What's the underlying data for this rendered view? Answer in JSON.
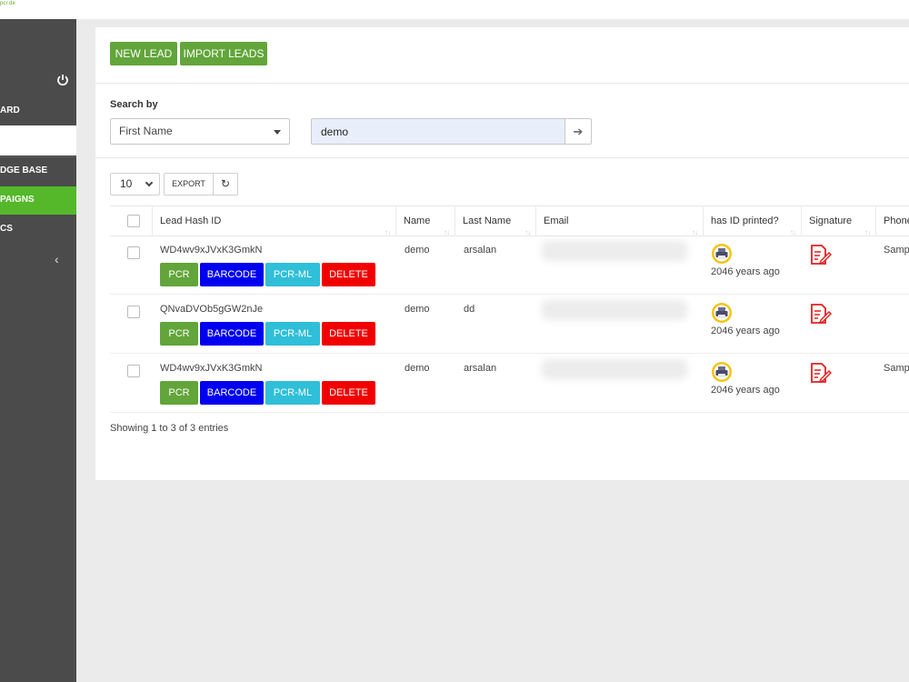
{
  "brand": "pcr.de",
  "sidebar": {
    "items": [
      {
        "label": "ARD"
      },
      {
        "label": "DGE BASE"
      },
      {
        "label": "PAIGNS"
      },
      {
        "label": "CS"
      }
    ],
    "collapse_glyph": "‹"
  },
  "toolbar": {
    "new_lead": "NEW LEAD",
    "import_leads": "IMPORT LEADS"
  },
  "search": {
    "label": "Search by",
    "field": "First Name",
    "value": "demo",
    "go_glyph": "➔"
  },
  "table_controls": {
    "page_length": "10",
    "export": "EXPORT",
    "refresh_glyph": "↻"
  },
  "table": {
    "columns": [
      "Lead Hash ID",
      "Name",
      "Last Name",
      "Email",
      "has ID printed?",
      "Signature",
      "Phone"
    ],
    "rows": [
      {
        "hash": "WD4wv9xJVxK3GmkN",
        "name": "demo",
        "last_name": "arsalan",
        "printed": "2046 years ago",
        "phone": "Samp"
      },
      {
        "hash": "QNvaDVOb5gGW2nJe",
        "name": "demo",
        "last_name": "dd",
        "printed": "2046 years ago",
        "phone": ""
      },
      {
        "hash": "WD4wv9xJVxK3GmkN",
        "name": "demo",
        "last_name": "arsalan",
        "printed": "2046 years ago",
        "phone": "Samp"
      }
    ],
    "actions": {
      "pcr": "PCR",
      "barcode": "BARCODE",
      "pcr_ml": "PCR-ML",
      "delete": "DELETE"
    },
    "sort_glyph": "↑↓"
  },
  "footer": {
    "showing": "Showing 1 to 3 of 3 entries"
  },
  "colors": {
    "sidebar": "#4b4b4b",
    "active": "#54b82a",
    "green_btn": "#62a53a",
    "barcode": "#0000f0",
    "pcr_ml": "#30bfd8",
    "delete": "#f20000"
  }
}
